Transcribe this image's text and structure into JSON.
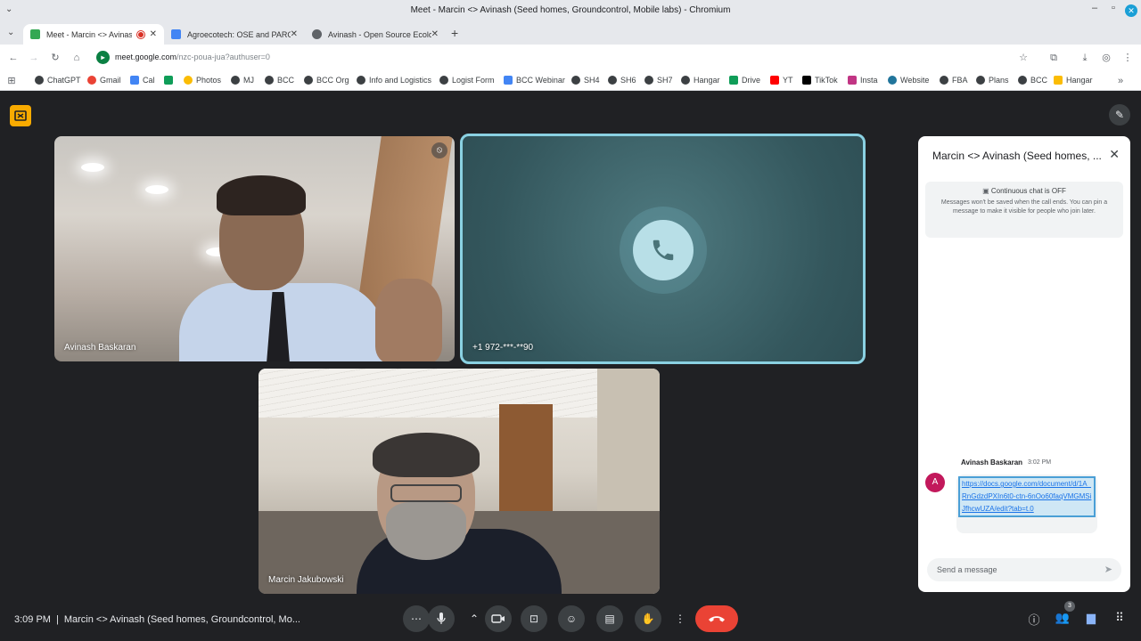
{
  "window": {
    "title": "Meet - Marcin <> Avinash (Seed homes, Groundcontrol, Mobile labs) - Chromium"
  },
  "tabs": [
    {
      "label": "Meet - Marcin <> Avinash",
      "favicon_color": "#34a853",
      "recording": true
    },
    {
      "label": "Agroecotech: OSE and PARC",
      "favicon_color": "#4285f4",
      "recording": false
    },
    {
      "label": "Avinash - Open Source Ecolo",
      "favicon_color": "#5f6368",
      "recording": false
    }
  ],
  "address": {
    "host": "meet.google.com",
    "path": "/nzc-poua-jua?authuser=0"
  },
  "bookmarks": [
    {
      "label": "ChatGPT",
      "color": "#3c4043"
    },
    {
      "label": "Gmail",
      "color": "#ea4335"
    },
    {
      "label": "Cal",
      "color": "#4285f4"
    },
    {
      "label": "",
      "color": "#0f9d58"
    },
    {
      "label": "Photos",
      "color": "#fbbc04"
    },
    {
      "label": "MJ",
      "color": "#3c4043"
    },
    {
      "label": "BCC",
      "color": "#3c4043"
    },
    {
      "label": "BCC Org",
      "color": "#3c4043"
    },
    {
      "label": "Info and Logistics",
      "color": "#3c4043"
    },
    {
      "label": "Logist Form",
      "color": "#3c4043"
    },
    {
      "label": "BCC Webinar",
      "color": "#4285f4"
    },
    {
      "label": "SH4",
      "color": "#3c4043"
    },
    {
      "label": "SH6",
      "color": "#3c4043"
    },
    {
      "label": "SH7",
      "color": "#3c4043"
    },
    {
      "label": "Hangar",
      "color": "#3c4043"
    },
    {
      "label": "Drive",
      "color": "#0f9d58"
    },
    {
      "label": "YT",
      "color": "#ff0000"
    },
    {
      "label": "TikTok",
      "color": "#000000"
    },
    {
      "label": "Insta",
      "color": "#c13584"
    },
    {
      "label": "Website",
      "color": "#21759b"
    },
    {
      "label": "FBA",
      "color": "#3c4043"
    },
    {
      "label": "Plans",
      "color": "#3c4043"
    },
    {
      "label": "BCC",
      "color": "#3c4043"
    },
    {
      "label": "Hangar",
      "color": "#fbbc04"
    }
  ],
  "participants": [
    {
      "name": "Avinash Baskaran",
      "muted": true
    },
    {
      "name": "+1 972-***-**90",
      "speaking": true
    },
    {
      "name": "Marcin Jakubowski"
    }
  ],
  "chat": {
    "title": "Marcin <> Avinash (Seed homes, ...",
    "notice_head": "Continuous chat is OFF",
    "notice_body": "Messages won't be saved when the call ends. You can pin a message to make it visible for people who join later.",
    "message": {
      "avatar_letter": "A",
      "avatar_color": "#c2185b",
      "sender": "Avinash Baskaran",
      "time": "3:02 PM",
      "link": "https://docs.google.com/document/d/1A_RnGdzdPXIn6t0-ctn-6nOo60faqVMGMSiJfhcwUZA/edit?tab=t.0"
    },
    "input_placeholder": "Send a message"
  },
  "bottom_bar": {
    "time": "3:09 PM",
    "meeting_title": "Marcin <> Avinash (Seed homes, Groundcontrol, Mo...",
    "people_count": "3",
    "end_call_color": "#ea4335"
  },
  "colors": {
    "meet_bg": "#202124",
    "speaking_border": "#8ad1e2",
    "accent": "#1a73e8"
  }
}
